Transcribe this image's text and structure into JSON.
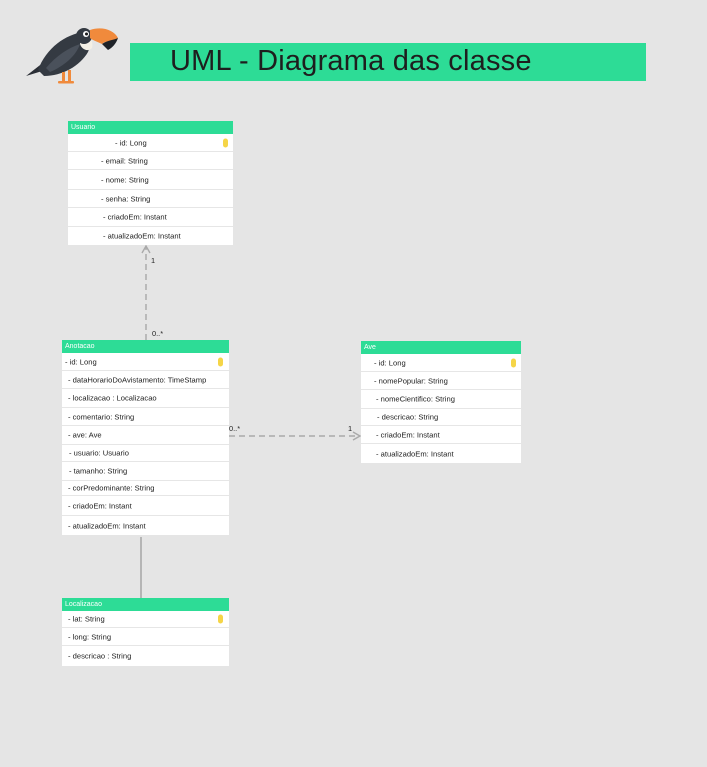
{
  "title": "UML - Diagrama das classe",
  "colors": {
    "accent": "#2ddc96",
    "key": "#f5d547",
    "background": "#e5e5e5"
  },
  "classes": {
    "usuario": {
      "name": "Usuario",
      "attributes": [
        "- id: Long",
        "- email: String",
        "- nome: String",
        "- senha: String",
        "- criadoEm: Instant",
        "- atualizadoEm: Instant"
      ]
    },
    "anotacao": {
      "name": "Anotacao",
      "attributes": [
        "- id: Long",
        "- dataHorarioDoAvistamento: TimeStamp",
        "- localizacao : Localizacao",
        "- comentario: String",
        "- ave: Ave",
        "- usuario: Usuario",
        "- tamanho: String",
        "- corPredominante: String",
        "- criadoEm: Instant",
        "- atualizadoEm: Instant"
      ]
    },
    "ave": {
      "name": "Ave",
      "attributes": [
        "- id: Long",
        "- nomePopular: String",
        "- nomeCientifico: String",
        "- descricao: String",
        "- criadoEm: Instant",
        "- atualizadoEm: Instant"
      ]
    },
    "localizacao": {
      "name": "Localizacao",
      "attributes": [
        "- lat: String",
        "- long: String",
        "- descricao : String"
      ]
    }
  },
  "relations": {
    "usuario_anotacao": {
      "source_mult": "1",
      "target_mult": "0..*"
    },
    "anotacao_ave": {
      "source_mult": "0..*",
      "target_mult": "1"
    }
  },
  "icons": {
    "logo": "toucan-icon",
    "primary_key": "key-icon"
  }
}
